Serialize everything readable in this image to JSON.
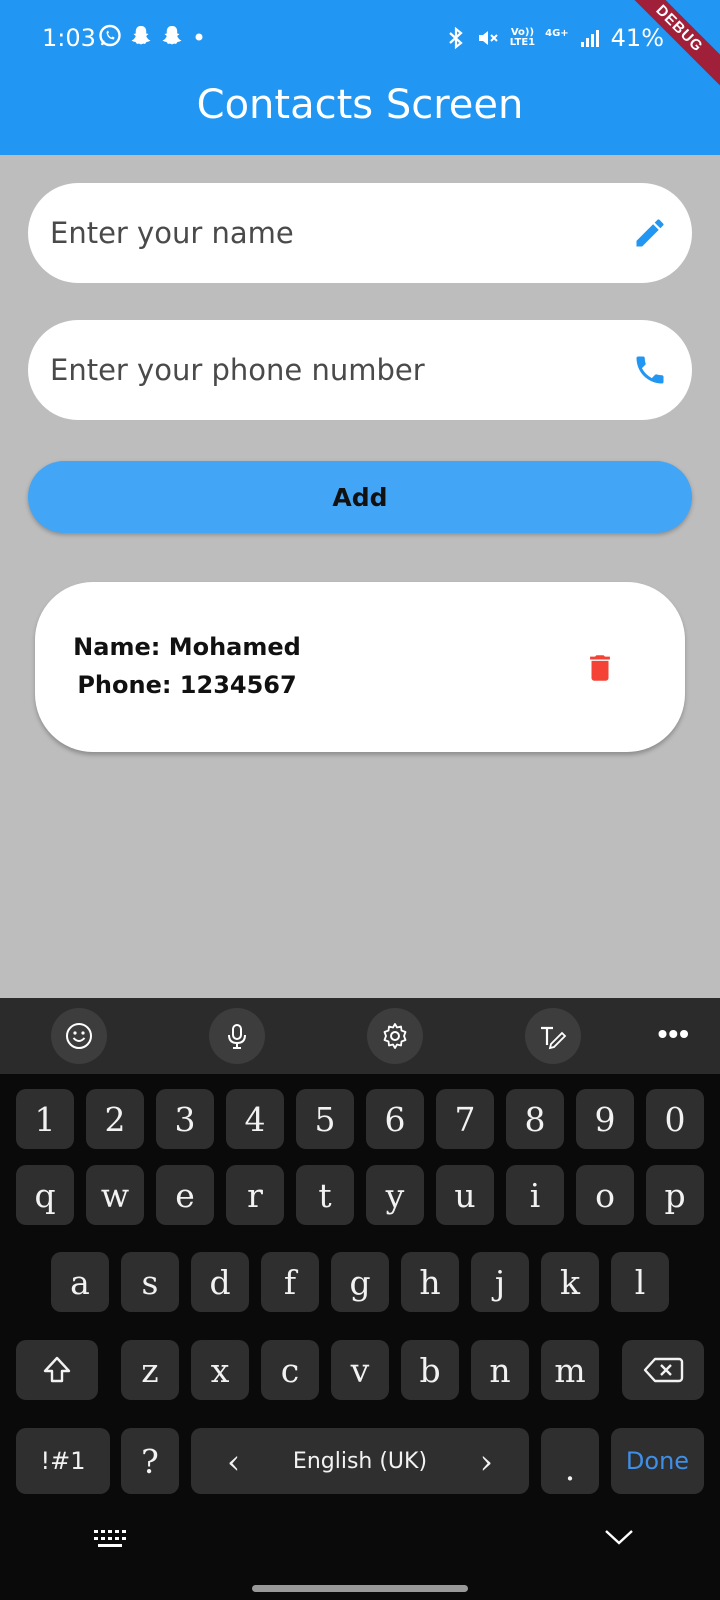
{
  "status_bar": {
    "time": "1:03",
    "battery": "41%",
    "network_top": "Vo))",
    "network_bottom": "LTE1",
    "data_type": "4G+",
    "left_icons": [
      "whatsapp-icon",
      "snapchat-icon",
      "snapchat-icon",
      "notification-dot-icon"
    ],
    "right_icons": [
      "bluetooth-icon",
      "mute-icon",
      "signal-icon",
      "battery-icon"
    ]
  },
  "app_bar": {
    "title": "Contacts Screen",
    "debug_label": "DEBUG",
    "color": "#2196f3"
  },
  "form": {
    "name_placeholder": "Enter your name",
    "name_value": "",
    "name_icon": "edit-pencil-icon",
    "phone_placeholder": "Enter your phone number",
    "phone_value": "",
    "phone_icon": "phone-icon",
    "add_label": "Add",
    "accent": "#42a5f5"
  },
  "contacts": [
    {
      "name_line": "Name: Mohamed",
      "phone_line": "Phone: 1234567",
      "delete_icon": "trash-icon",
      "delete_color": "#f44336"
    }
  ],
  "keyboard": {
    "toolbar_icons": [
      "emoji-icon",
      "microphone-icon",
      "settings-icon",
      "handwriting-icon",
      "more-icon"
    ],
    "toolbar_more": "•••",
    "number_row": [
      "1",
      "2",
      "3",
      "4",
      "5",
      "6",
      "7",
      "8",
      "9",
      "0"
    ],
    "row1": [
      "q",
      "w",
      "e",
      "r",
      "t",
      "y",
      "u",
      "i",
      "o",
      "p"
    ],
    "row2": [
      "a",
      "s",
      "d",
      "f",
      "g",
      "h",
      "j",
      "k",
      "l"
    ],
    "row3": [
      "z",
      "x",
      "c",
      "v",
      "b",
      "n",
      "m"
    ],
    "symbols_key": "!#1",
    "question_key": "?",
    "language": "English (UK)",
    "left_arrow": "‹",
    "right_arrow": "›",
    "period_key": ".",
    "done_key": "Done",
    "nav_icons": [
      "keyboard-switch-icon",
      "hide-keyboard-icon"
    ]
  }
}
